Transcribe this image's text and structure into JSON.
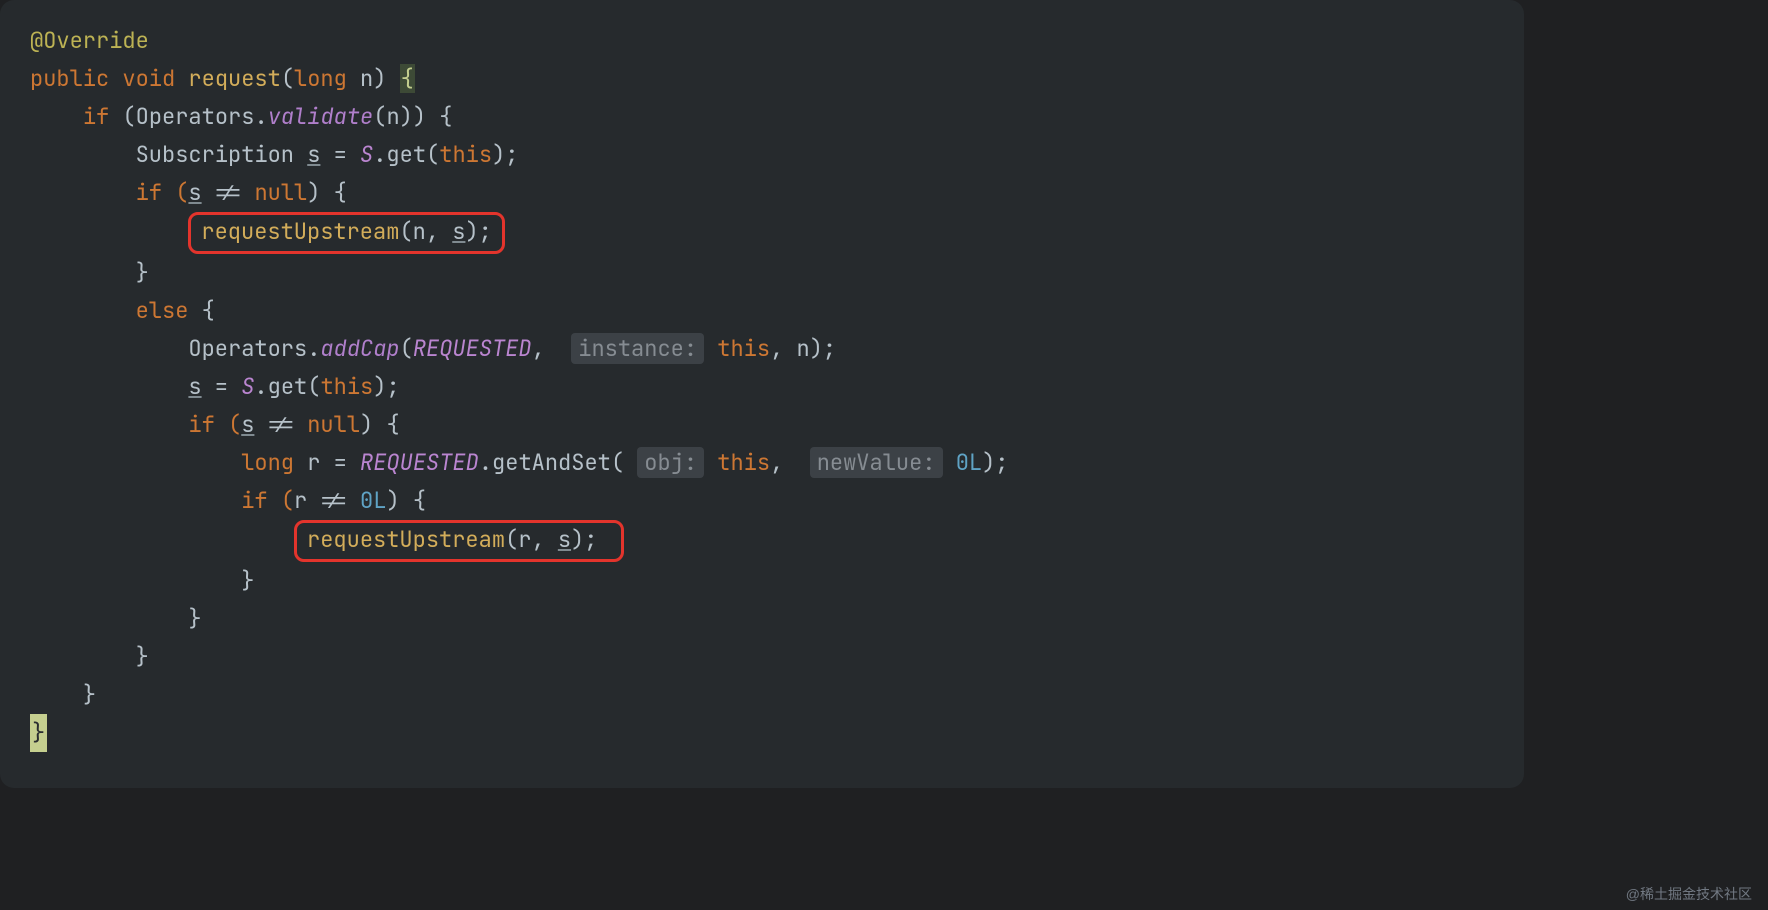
{
  "watermark": "@稀土掘金技术社区",
  "code": {
    "l1_ann": "@Override",
    "l2": {
      "kw_public": "public",
      "kw_void": "void",
      "fn": "request",
      "lp": "(",
      "kw_long": "long",
      "sp": " ",
      "arg": "n",
      "rp": ") ",
      "ob": "{"
    },
    "l3": {
      "indent": "    ",
      "kw_if": "if ",
      "lp": "(",
      "cls": "Operators",
      "dot": ".",
      "fn": "validate",
      "lp2": "(",
      "arg": "n",
      "rp2": ")) {"
    },
    "l4": {
      "indent": "        ",
      "type": "Subscription ",
      "var": "s",
      "eq": " = ",
      "fld": "S",
      "call": ".get(",
      "kw_this": "this",
      "end": ");"
    },
    "l5": {
      "indent": "        ",
      "kw_if": "if (",
      "var": "s",
      "mid": " != ",
      "kw_null": "null",
      "end": ") {"
    },
    "l6": {
      "indent": "            ",
      "fn": "requestUpstream",
      "lp": "(",
      "a1": "n",
      "c": ", ",
      "a2": "s",
      "rp": ");"
    },
    "l7": {
      "indent": "        ",
      "cb": "}"
    },
    "l8": {
      "indent": "        ",
      "kw": "else ",
      "ob": "{"
    },
    "l9": {
      "indent": "            ",
      "cls": "Operators",
      "dot": ".",
      "fn": "addCap",
      "lp": "(",
      "p1": "REQUESTED",
      "c1": ", ",
      "hint": "instance:",
      "sp": " ",
      "kw_this": "this",
      "c2": ", ",
      "a3": "n",
      "rp": ");"
    },
    "l10": {
      "indent": "            ",
      "var": "s",
      "eq": " = ",
      "fld": "S",
      "call": ".get(",
      "kw_this": "this",
      "end": ");"
    },
    "l11": {
      "indent": "            ",
      "kw_if": "if (",
      "var": "s",
      "mid": " != ",
      "kw_null": "null",
      "end": ") {"
    },
    "l12": {
      "indent": "                ",
      "kw_long": "long",
      "sp": " ",
      "v": "r",
      "eq": " = ",
      "fld": "REQUESTED",
      "call": ".getAndSet(",
      "hint1": "obj:",
      "sp1": " ",
      "kw_this": "this",
      "c1": ", ",
      "hint2": "newValue:",
      "sp2": " ",
      "num": "0L",
      "rp": ");"
    },
    "l13": {
      "indent": "                ",
      "kw_if": "if (",
      "v": "r",
      "mid": " != ",
      "num": "0L",
      "end": ") {"
    },
    "l14": {
      "indent": "                    ",
      "fn": "requestUpstream",
      "lp": "(",
      "a1": "r",
      "c": ", ",
      "a2": "s",
      "rp": ");"
    },
    "l15": {
      "indent": "                ",
      "cb": "}"
    },
    "l16": {
      "indent": "            ",
      "cb": "}"
    },
    "l17_blank": "",
    "l18": {
      "indent": "        ",
      "cb": "}"
    },
    "l19": {
      "indent": "    ",
      "cb": "}"
    },
    "l20": {
      "cb": "}"
    }
  }
}
